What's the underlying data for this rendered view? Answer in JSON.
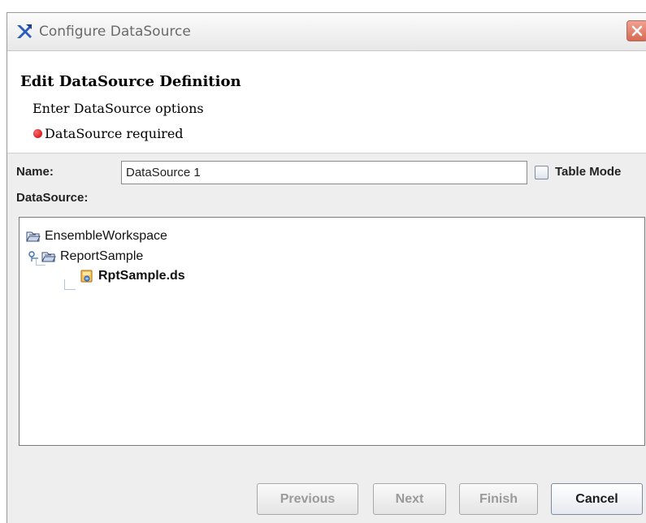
{
  "window": {
    "title": "Configure DataSource"
  },
  "header": {
    "title": "Edit DataSource Definition",
    "subtitle": "Enter DataSource options",
    "error": "DataSource required"
  },
  "form": {
    "name_label": "Name:",
    "name_value": "DataSource 1",
    "table_mode_label": "Table Mode",
    "table_mode_checked": false,
    "datasource_label": "DataSource:"
  },
  "tree": {
    "nodes": [
      {
        "label": "EnsembleWorkspace",
        "icon": "folder-open-icon",
        "level": 0
      },
      {
        "label": "ReportSample",
        "icon": "folder-open-icon",
        "level": 1
      },
      {
        "label": "RptSample.ds",
        "icon": "datasource-file-icon",
        "level": 2,
        "selected": true
      }
    ]
  },
  "buttons": {
    "previous": "Previous",
    "next": "Next",
    "finish": "Finish",
    "cancel": "Cancel"
  },
  "colors": {
    "error": "#cc0000",
    "disabled_text": "#9a9a9a"
  }
}
